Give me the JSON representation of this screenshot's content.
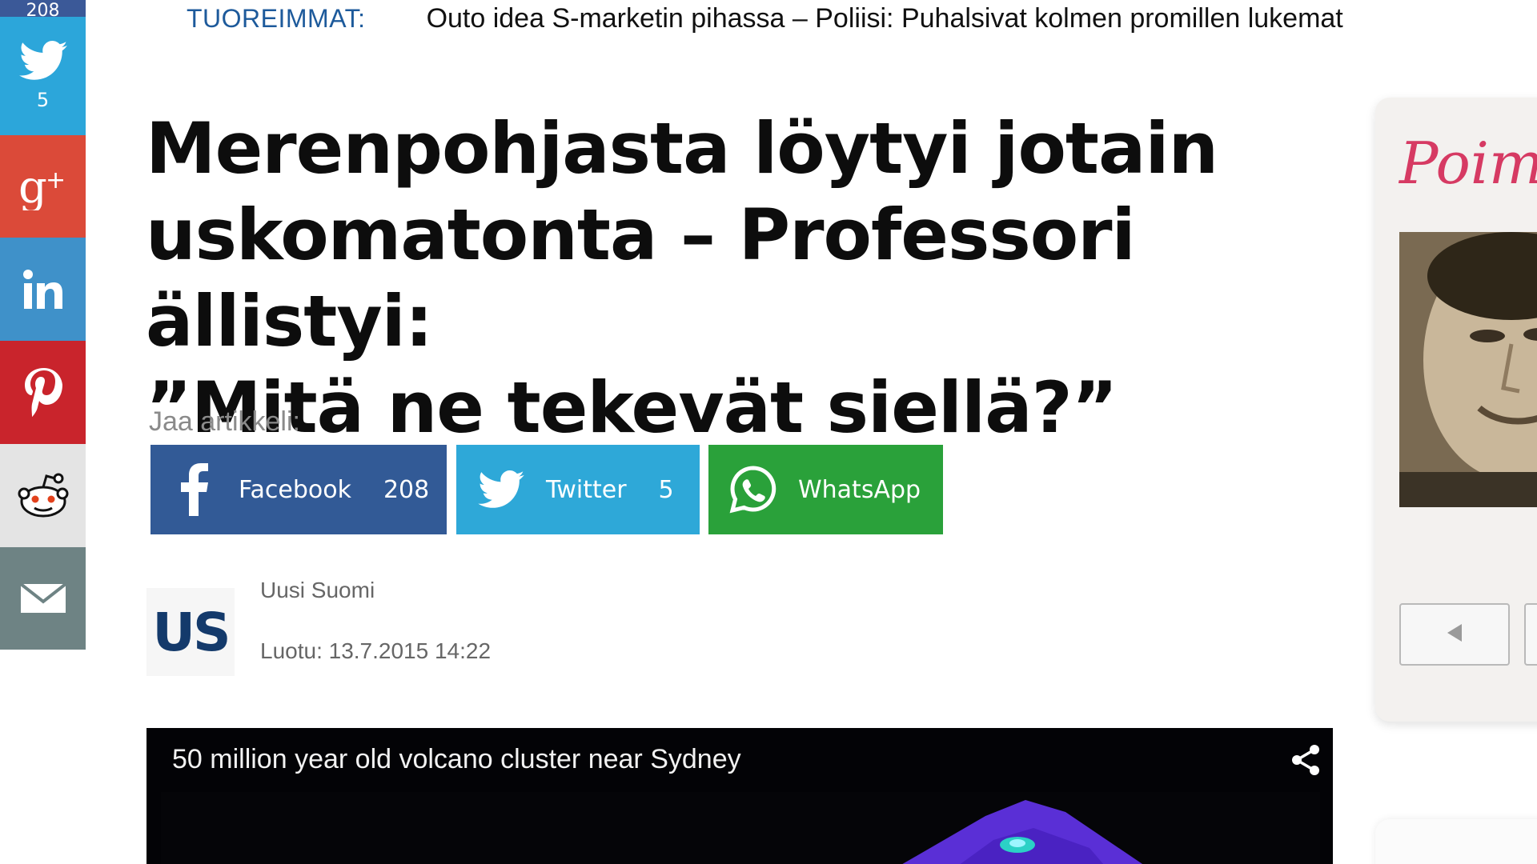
{
  "social_rail": {
    "facebook": {
      "count": "208",
      "icon": "facebook-icon",
      "color": "#3b5998"
    },
    "twitter": {
      "count": "5",
      "icon": "twitter-icon",
      "color": "#2ca6da"
    },
    "googleplus": {
      "icon": "googleplus-icon",
      "color": "#db4a39"
    },
    "linkedin": {
      "icon": "linkedin-icon",
      "color": "#3f91c9"
    },
    "pinterest": {
      "icon": "pinterest-icon",
      "color": "#c9242c"
    },
    "reddit": {
      "icon": "reddit-icon",
      "color": "#e4e4e4"
    },
    "email": {
      "icon": "email-icon",
      "color": "#6e8384"
    }
  },
  "ticker": {
    "label": "TUOREIMMAT:",
    "text": "Outo idea S-marketin pihassa – Poliisi: Puhalsivat kolmen promillen lukemat"
  },
  "article": {
    "headline_line1": "Merenpohjasta löytyi jotain",
    "headline_line2": "uskomatonta – Professori ällistyi:",
    "headline_line3": "”Mitä ne tekevät siellä?”"
  },
  "share": {
    "label": "Jaa artikkeli:",
    "facebook": {
      "label": "Facebook",
      "count": "208"
    },
    "twitter": {
      "label": "Twitter",
      "count": "5"
    },
    "whatsapp": {
      "label": "WhatsApp"
    }
  },
  "byline": {
    "logo_text": "US",
    "source": "Uusi Suomi",
    "published": "Luotu: 13.7.2015 14:22"
  },
  "video": {
    "title": "50 million year old volcano cluster near Sydney"
  },
  "widget": {
    "script_title": "Poim"
  },
  "colors": {
    "ticker_label": "#1d5a9b",
    "facebook": "#325a96",
    "twitter": "#2ea8d8",
    "whatsapp": "#2aa13a",
    "widget_accent": "#d63a63"
  }
}
